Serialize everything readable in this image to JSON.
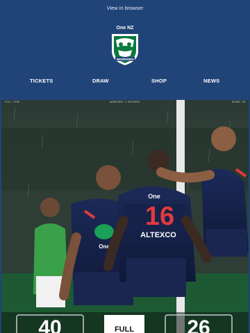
{
  "header": {
    "view_in_browser": "View in browser"
  },
  "brand": {
    "sponsor": "One NZ",
    "logo_name": "WARRIORS"
  },
  "nav": {
    "items": [
      "TICKETS",
      "DRAW",
      "SHOP",
      "NEWS"
    ]
  },
  "hero": {
    "caption_left": "FULL-TIME",
    "caption_center": "WARRIORS V RAIDERS",
    "caption_right": "ROUND 4B",
    "jersey_number": "16",
    "jersey_sponsor_chest": "One",
    "jersey_sponsor_top": "One",
    "jersey_sponsor_mid": "ALTEXCO",
    "score_left": "40",
    "score_right": "26",
    "score_center": "FULL"
  },
  "colors": {
    "background": "#214478",
    "accent_red": "#e03a3e",
    "accent_green": "#00a651"
  }
}
